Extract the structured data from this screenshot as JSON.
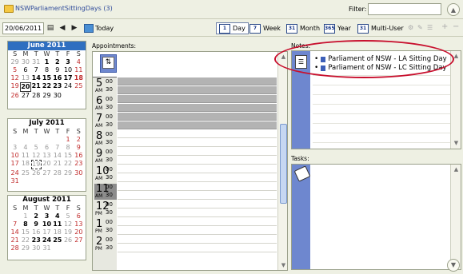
{
  "title": "NSWParliamentSittingDays (3)",
  "filter": {
    "label": "Filter:",
    "value": ""
  },
  "toolbar": {
    "date": "20/06/2011",
    "today_label": "Today",
    "views": [
      {
        "num": "1",
        "label": "Day"
      },
      {
        "num": "7",
        "label": "Week"
      },
      {
        "num": "31",
        "label": "Month"
      },
      {
        "num": "365",
        "label": "Year"
      },
      {
        "num": "31",
        "label": "Multi-User"
      }
    ]
  },
  "calendars": [
    {
      "title": "June 2011"
    },
    {
      "title": "July 2011"
    },
    {
      "title": "August 2011"
    }
  ],
  "day_letters": [
    "S",
    "M",
    "T",
    "W",
    "T",
    "F",
    "S"
  ],
  "appointments": {
    "label": "Appointments:",
    "hours": [
      {
        "h": "5",
        "ap": "AM"
      },
      {
        "h": "6",
        "ap": "AM"
      },
      {
        "h": "7",
        "ap": "AM"
      },
      {
        "h": "8",
        "ap": "AM"
      },
      {
        "h": "9",
        "ap": "AM"
      },
      {
        "h": "10",
        "ap": "AM"
      },
      {
        "h": "11",
        "ap": "AM"
      },
      {
        "h": "12",
        "ap": "PM"
      },
      {
        "h": "1",
        "ap": "PM"
      },
      {
        "h": "2",
        "ap": "PM"
      }
    ],
    "m00": "00",
    "m30": "30"
  },
  "notes": {
    "label": "Notes:",
    "items": [
      "Parliament of NSW - LA Sitting Day",
      "Parliament of NSW - LC Sitting Day"
    ]
  },
  "tasks": {
    "label": "Tasks:"
  }
}
